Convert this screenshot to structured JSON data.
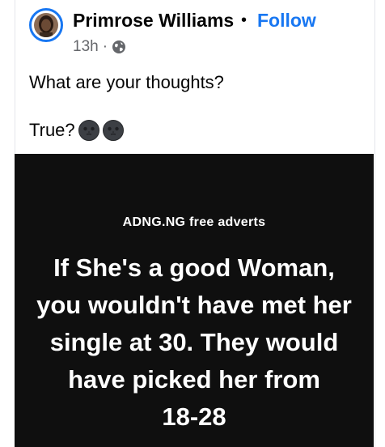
{
  "post": {
    "author": "Primrose Williams",
    "separator_dot": "•",
    "follow_label": "Follow",
    "time": "13h",
    "meta_sep": "·",
    "privacy_icon": "globe-icon",
    "text_line1": "What are your thoughts?",
    "text_line2": "True?",
    "emojis": [
      "new-moon-face-icon",
      "new-moon-face-icon"
    ]
  },
  "image": {
    "watermark": "ADNG.NG free adverts",
    "quote_lines": [
      "If She's a good Woman,",
      "you wouldn't have met her",
      "single at 30. They would",
      "have picked her from",
      "18-28"
    ]
  },
  "colors": {
    "accent": "#1877f2",
    "text": "#050505",
    "secondary": "#65676b",
    "image_bg": "#0f0f0f"
  }
}
